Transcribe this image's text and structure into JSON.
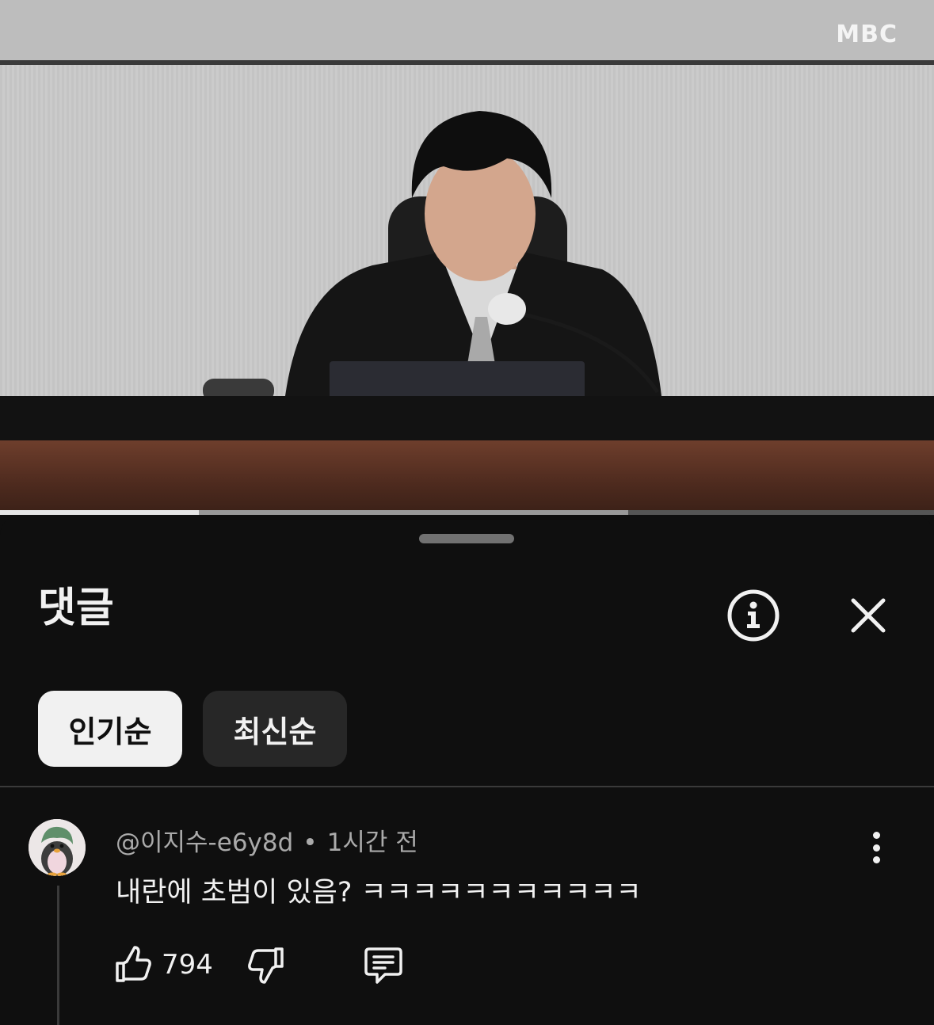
{
  "video": {
    "watermark": "MBC",
    "progress": {
      "played_fraction": 0.213,
      "buffered_fraction": 0.673
    }
  },
  "comments_panel": {
    "title": "댓글",
    "info_icon": "info-circle-icon",
    "close_icon": "close-x-icon",
    "sort_options": [
      {
        "label": "인기순",
        "selected": true
      },
      {
        "label": "최신순",
        "selected": false
      }
    ]
  },
  "comments": [
    {
      "author": "@이지수-e6y8d",
      "separator": "•",
      "time": "1시간 전",
      "text": "내란에 초범이 있음? ㅋㅋㅋㅋㅋㅋㅋㅋㅋㅋㅋ",
      "likes": "794",
      "icons": {
        "like": "thumbs-up-icon",
        "dislike": "thumbs-down-icon",
        "reply": "reply-icon",
        "more": "more-vertical-icon"
      }
    }
  ],
  "colors": {
    "background": "#0f0f0f",
    "text_primary": "#f1f1f1",
    "text_secondary": "#aaaaaa",
    "chip_active_bg": "#f1f1f1",
    "chip_inactive_bg": "#272727"
  }
}
